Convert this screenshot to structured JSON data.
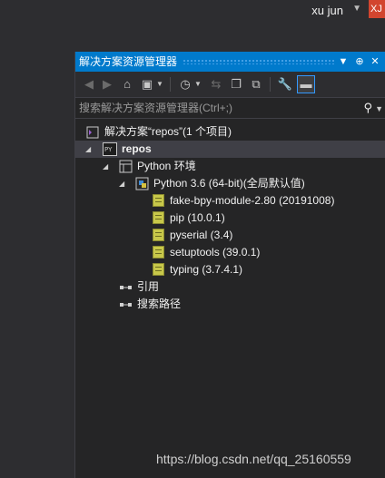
{
  "window": {
    "user_name": "xu jun",
    "user_badge": "XJ"
  },
  "panel": {
    "title": "解决方案资源管理器",
    "search_placeholder": "搜索解决方案资源管理器(Ctrl+;)"
  },
  "tree": {
    "solution": "解决方案“repos”(1 个项目)",
    "project": "repos",
    "py_env": "Python 环境",
    "interpreter": "Python 3.6 (64-bit)(全局默认值)",
    "packages": [
      "fake-bpy-module-2.80 (20191008)",
      "pip (10.0.1)",
      "pyserial (3.4)",
      "setuptools (39.0.1)",
      "typing (3.7.4.1)"
    ],
    "references": "引用",
    "search_paths": "搜索路径"
  },
  "watermark": "https://blog.csdn.net/qq_25160559",
  "colors": {
    "accent": "#007acc",
    "background": "#252526"
  }
}
